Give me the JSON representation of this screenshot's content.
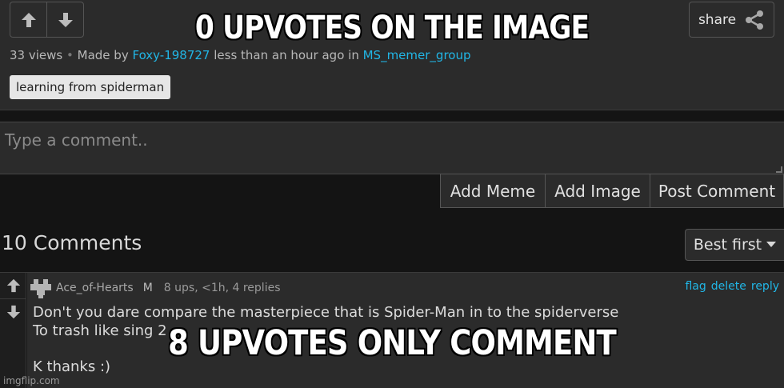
{
  "captions": {
    "top": "0 UPVOTES ON THE IMAGE",
    "bottom": "8 UPVOTES ONLY COMMENT"
  },
  "post": {
    "views": "33 views",
    "separator": "•",
    "made_by_prefix": "Made by",
    "author": "Foxy-198727",
    "time_phrase": "less than an hour ago in",
    "stream": "MS_memer_group",
    "tag": "learning from spiderman",
    "share_label": "share",
    "icons": {
      "upvote": "arrow-up-icon",
      "downvote": "arrow-down-icon",
      "share": "share-icon"
    }
  },
  "comment_form": {
    "placeholder": "Type a comment..",
    "buttons": {
      "add_meme": "Add Meme",
      "add_image": "Add Image",
      "post_comment": "Post Comment"
    }
  },
  "comments_header": {
    "count_label": "10 Comments",
    "sort_label": "Best first"
  },
  "comment": {
    "username": "Ace_of-Hearts",
    "role": "M",
    "stats": "8 ups, <1h, 4 replies",
    "links": {
      "flag": "flag",
      "delete": "delete",
      "reply": "reply"
    },
    "lines": [
      "Don't you dare compare the masterpiece that is Spider-Man in to the spiderverse",
      "To trash like sing 2",
      "",
      "K thanks :)"
    ]
  },
  "watermark": "imgflip.com",
  "colors": {
    "background": "#141414",
    "panel": "#2b2b2b",
    "link": "#21b6e6",
    "tag_bg": "#e6e6e6"
  }
}
